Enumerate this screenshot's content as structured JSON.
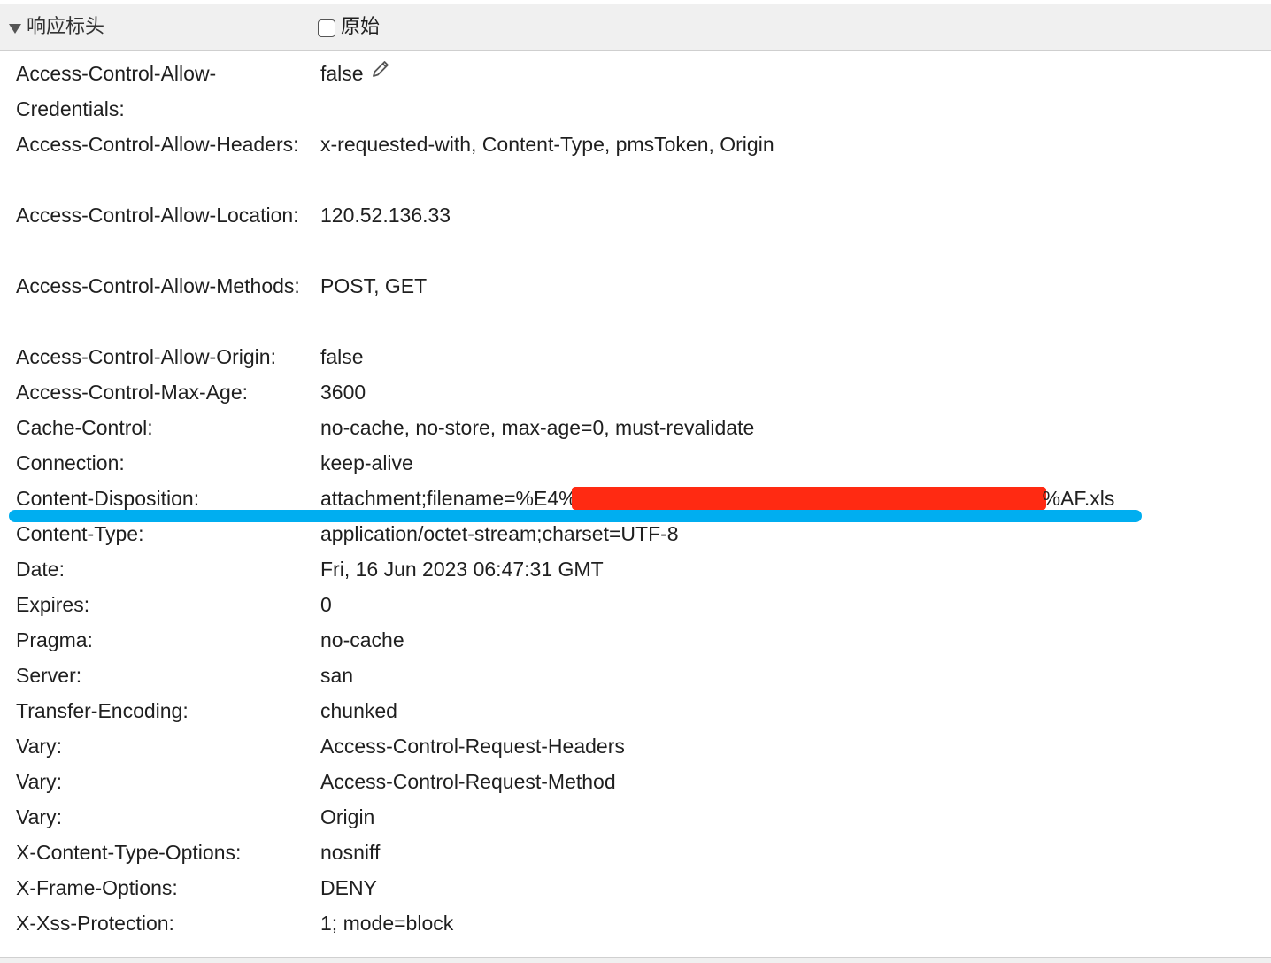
{
  "section": {
    "title": "响应标头",
    "raw_label": "原始"
  },
  "headers": [
    {
      "name": "Access-Control-Allow-Credentials:",
      "value": "false"
    },
    {
      "name": "Access-Control-Allow-Headers:",
      "value": "x-requested-with, Content-Type, pmsToken, Origin"
    },
    {
      "name": "Access-Control-Allow-Location:",
      "value": "120.52.136.33"
    },
    {
      "name": "Access-Control-Allow-Methods:",
      "value": "POST, GET"
    },
    {
      "name": "Access-Control-Allow-Origin:",
      "value": "false"
    },
    {
      "name": "Access-Control-Max-Age:",
      "value": "3600"
    },
    {
      "name": "Cache-Control:",
      "value": "no-cache, no-store, max-age=0, must-revalidate"
    },
    {
      "name": "Connection:",
      "value": "keep-alive"
    },
    {
      "name": "Content-Disposition:",
      "value_prefix": "attachment;filename=%E4%",
      "value_suffix": "%AF.xls"
    },
    {
      "name": "Content-Type:",
      "value": "application/octet-stream;charset=UTF-8"
    },
    {
      "name": "Date:",
      "value": "Fri, 16 Jun 2023 06:47:31 GMT"
    },
    {
      "name": "Expires:",
      "value": "0"
    },
    {
      "name": "Pragma:",
      "value": "no-cache"
    },
    {
      "name": "Server:",
      "value": "san"
    },
    {
      "name": "Transfer-Encoding:",
      "value": "chunked"
    },
    {
      "name": "Vary:",
      "value": "Access-Control-Request-Headers"
    },
    {
      "name": "Vary:",
      "value": "Access-Control-Request-Method"
    },
    {
      "name": "Vary:",
      "value": "Origin"
    },
    {
      "name": "X-Content-Type-Options:",
      "value": "nosniff"
    },
    {
      "name": "X-Frame-Options:",
      "value": "DENY"
    },
    {
      "name": "X-Xss-Protection:",
      "value": "1; mode=block"
    }
  ],
  "colors": {
    "redaction": "#ff2a12",
    "highlight_line": "#00aef0",
    "header_bg": "#f0f0f0"
  }
}
